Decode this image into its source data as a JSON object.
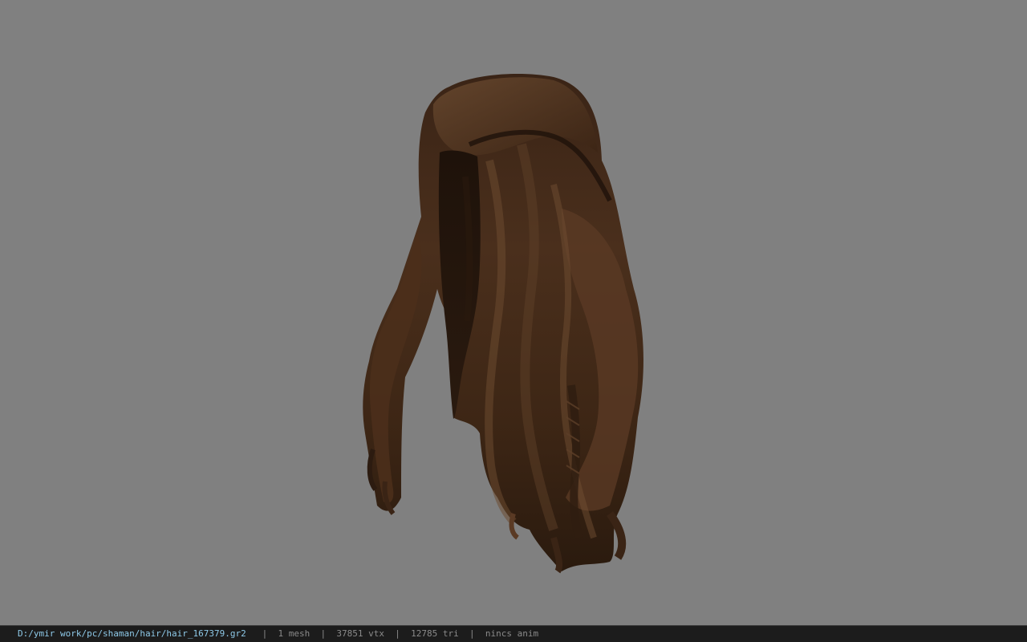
{
  "viewport": {
    "background_color": "#808080",
    "model_name": "hair"
  },
  "statusbar": {
    "file_path": "D:/ymir work/pc/shaman/hair/hair_167379.gr2",
    "separator": "|",
    "mesh_count": "1 mesh",
    "vertex_count": "37851 vtx",
    "triangle_count": "12785 tri",
    "anim_status": "nincs anim",
    "colors": {
      "path": "#8ec9e8",
      "text": "#8a8a8a",
      "background": "#1c1c1c"
    }
  }
}
